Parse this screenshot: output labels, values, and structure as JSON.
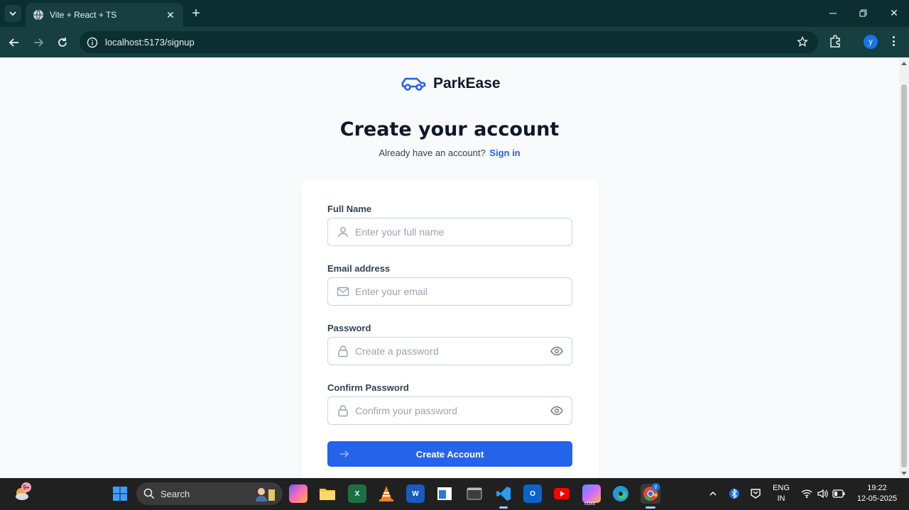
{
  "browser": {
    "tab_title": "Vite + React + TS",
    "url": "localhost:5173/signup",
    "profile_initial": "y"
  },
  "page": {
    "brand": "ParkEase",
    "heading": "Create your account",
    "subheading": "Already have an account?",
    "signin_link": "Sign in",
    "fields": [
      {
        "label": "Full Name",
        "placeholder": "Enter your full name",
        "icon": "user-icon"
      },
      {
        "label": "Email address",
        "placeholder": "Enter your email",
        "icon": "mail-icon"
      },
      {
        "label": "Password",
        "placeholder": "Create a password",
        "icon": "lock-icon"
      },
      {
        "label": "Confirm Password",
        "placeholder": "Confirm your password",
        "icon": "lock-icon"
      }
    ],
    "submit_label": "Create Account",
    "accent_color": "#2563eb"
  },
  "taskbar": {
    "search_label": "Search",
    "weather_badge": "9+",
    "chrome_badge": "y",
    "copilot_m365_label": "M365",
    "language": "ENG",
    "region": "IN",
    "time": "19:22",
    "date": "12-05-2025"
  }
}
